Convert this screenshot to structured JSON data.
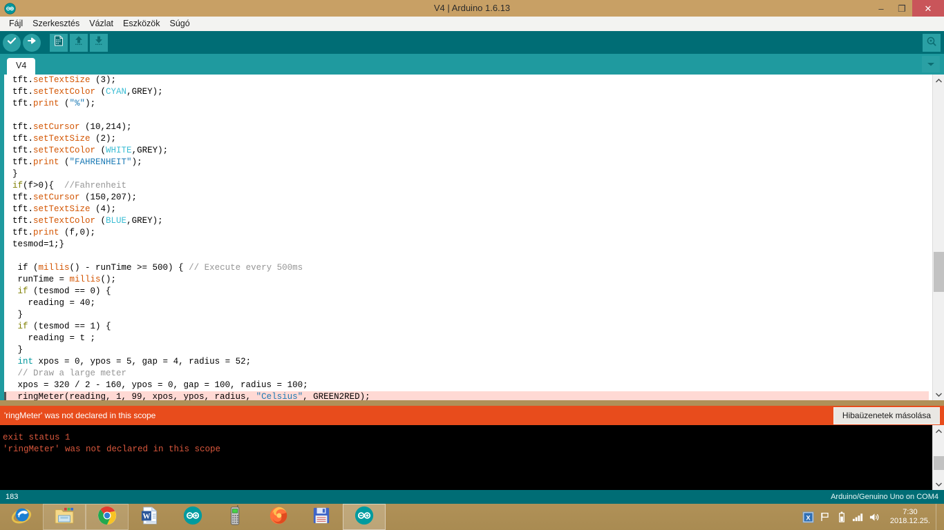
{
  "window": {
    "title": "V4 | Arduino 1.6.13",
    "logo_icon": "arduino-infinity-logo",
    "minimize_label": "–",
    "maximize_label": "❐",
    "close_label": "✕"
  },
  "menubar": {
    "items": [
      {
        "label": "Fájl",
        "name": "menu-file"
      },
      {
        "label": "Szerkesztés",
        "name": "menu-edit"
      },
      {
        "label": "Vázlat",
        "name": "menu-sketch"
      },
      {
        "label": "Eszközök",
        "name": "menu-tools"
      },
      {
        "label": "Súgó",
        "name": "menu-help"
      }
    ]
  },
  "toolbar": {
    "verify": "verify-check-icon",
    "upload": "upload-arrow-icon",
    "new": "new-sketch-icon",
    "open": "open-up-arrow-icon",
    "save": "save-down-arrow-icon",
    "serial_monitor": "serial-monitor-magnifier-icon"
  },
  "tabs": {
    "active": "V4",
    "dropdown_icon": "chevron-down-icon"
  },
  "editor": {
    "lines": [
      {
        "indent": 1,
        "tokens": [
          {
            "t": "tft.",
            "c": "plain"
          },
          {
            "t": "setTextSize",
            "c": "fn"
          },
          {
            "t": " (3);",
            "c": "plain"
          }
        ]
      },
      {
        "indent": 1,
        "tokens": [
          {
            "t": "tft.",
            "c": "plain"
          },
          {
            "t": "setTextColor",
            "c": "fn"
          },
          {
            "t": " (",
            "c": "plain"
          },
          {
            "t": "CYAN",
            "c": "const"
          },
          {
            "t": ",GREY);",
            "c": "plain"
          }
        ]
      },
      {
        "indent": 1,
        "tokens": [
          {
            "t": "tft.",
            "c": "plain"
          },
          {
            "t": "print",
            "c": "fn"
          },
          {
            "t": " (",
            "c": "plain"
          },
          {
            "t": "\"%\"",
            "c": "str"
          },
          {
            "t": ");",
            "c": "plain"
          }
        ]
      },
      {
        "indent": 0,
        "tokens": []
      },
      {
        "indent": 1,
        "tokens": [
          {
            "t": "tft.",
            "c": "plain"
          },
          {
            "t": "setCursor",
            "c": "fn"
          },
          {
            "t": " (10,214);",
            "c": "plain"
          }
        ]
      },
      {
        "indent": 1,
        "tokens": [
          {
            "t": "tft.",
            "c": "plain"
          },
          {
            "t": "setTextSize",
            "c": "fn"
          },
          {
            "t": " (2);",
            "c": "plain"
          }
        ]
      },
      {
        "indent": 1,
        "tokens": [
          {
            "t": "tft.",
            "c": "plain"
          },
          {
            "t": "setTextColor",
            "c": "fn"
          },
          {
            "t": " (",
            "c": "plain"
          },
          {
            "t": "WHITE",
            "c": "const"
          },
          {
            "t": ",GREY);",
            "c": "plain"
          }
        ]
      },
      {
        "indent": 1,
        "tokens": [
          {
            "t": "tft.",
            "c": "plain"
          },
          {
            "t": "print",
            "c": "fn"
          },
          {
            "t": " (",
            "c": "plain"
          },
          {
            "t": "\"FAHRENHEIT\"",
            "c": "str"
          },
          {
            "t": ");",
            "c": "plain"
          }
        ]
      },
      {
        "indent": 1,
        "tokens": [
          {
            "t": "}",
            "c": "plain"
          }
        ]
      },
      {
        "indent": 1,
        "tokens": [
          {
            "t": "if",
            "c": "kw"
          },
          {
            "t": "(f>0){  ",
            "c": "plain"
          },
          {
            "t": "//Fahrenheit",
            "c": "com"
          }
        ]
      },
      {
        "indent": 1,
        "tokens": [
          {
            "t": "tft.",
            "c": "plain"
          },
          {
            "t": "setCursor",
            "c": "fn"
          },
          {
            "t": " (150,207);",
            "c": "plain"
          }
        ]
      },
      {
        "indent": 1,
        "tokens": [
          {
            "t": "tft.",
            "c": "plain"
          },
          {
            "t": "setTextSize",
            "c": "fn"
          },
          {
            "t": " (4);",
            "c": "plain"
          }
        ]
      },
      {
        "indent": 1,
        "tokens": [
          {
            "t": "tft.",
            "c": "plain"
          },
          {
            "t": "setTextColor",
            "c": "fn"
          },
          {
            "t": " (",
            "c": "plain"
          },
          {
            "t": "BLUE",
            "c": "const"
          },
          {
            "t": ",GREY);",
            "c": "plain"
          }
        ]
      },
      {
        "indent": 1,
        "tokens": [
          {
            "t": "tft.",
            "c": "plain"
          },
          {
            "t": "print",
            "c": "fn"
          },
          {
            "t": " (f,0);",
            "c": "plain"
          }
        ]
      },
      {
        "indent": 1,
        "tokens": [
          {
            "t": "tesmod=1;}",
            "c": "plain"
          }
        ]
      },
      {
        "indent": 0,
        "tokens": []
      },
      {
        "indent": 0,
        "tokens": [
          {
            "t": " if (",
            "c": "plain"
          },
          {
            "t": "millis",
            "c": "fn"
          },
          {
            "t": "() - runTime >= 500) { ",
            "c": "plain"
          },
          {
            "t": "// Execute every 500ms",
            "c": "com"
          }
        ]
      },
      {
        "indent": 1,
        "tokens": [
          {
            "t": " runTime = ",
            "c": "plain"
          },
          {
            "t": "millis",
            "c": "fn"
          },
          {
            "t": "();",
            "c": "plain"
          }
        ]
      },
      {
        "indent": 1,
        "tokens": [
          {
            "t": " ",
            "c": "plain"
          },
          {
            "t": "if",
            "c": "kw"
          },
          {
            "t": " (tesmod == 0) {",
            "c": "plain"
          }
        ]
      },
      {
        "indent": 1,
        "tokens": [
          {
            "t": "   reading = 40;",
            "c": "plain"
          }
        ]
      },
      {
        "indent": 1,
        "tokens": [
          {
            "t": " }",
            "c": "plain"
          }
        ]
      },
      {
        "indent": 1,
        "tokens": [
          {
            "t": " ",
            "c": "plain"
          },
          {
            "t": "if",
            "c": "kw"
          },
          {
            "t": " (tesmod == 1) {",
            "c": "plain"
          }
        ]
      },
      {
        "indent": 1,
        "tokens": [
          {
            "t": "   reading = t ;",
            "c": "plain"
          }
        ]
      },
      {
        "indent": 1,
        "tokens": [
          {
            "t": " }",
            "c": "plain"
          }
        ]
      },
      {
        "indent": 1,
        "tokens": [
          {
            "t": " ",
            "c": "plain"
          },
          {
            "t": "int",
            "c": "type"
          },
          {
            "t": " xpos = 0, ypos = 5, gap = 4, radius = 52;",
            "c": "plain"
          }
        ]
      },
      {
        "indent": 1,
        "tokens": [
          {
            "t": " ",
            "c": "plain"
          },
          {
            "t": "// Draw a large meter",
            "c": "com"
          }
        ]
      },
      {
        "indent": 1,
        "tokens": [
          {
            "t": " xpos = 320 / 2 - 160, ypos = 0, gap = 100, radius = 100;",
            "c": "plain"
          }
        ]
      },
      {
        "indent": 1,
        "highlight": true,
        "tokens": [
          {
            "t": " ringMeter(reading, 1, 99, xpos, ypos, radius, ",
            "c": "plain"
          },
          {
            "t": "\"Celsius\"",
            "c": "str"
          },
          {
            "t": ", GREEN2RED);",
            "c": "plain"
          }
        ]
      }
    ],
    "scroll_up_icon": "chevron-up-icon",
    "scroll_down_icon": "chevron-down-icon"
  },
  "error_bar": {
    "message": "'ringMeter' was not declared in this scope",
    "copy_button": "Hibaüzenetek másolása"
  },
  "console": {
    "text": "exit status 1\n'ringMeter' was not declared in this scope"
  },
  "statusbar": {
    "line_number": "183",
    "board": "Arduino/Genuino Uno on COM4"
  },
  "taskbar": {
    "items": [
      {
        "name": "taskbar-internet-explorer",
        "icon": "internet-explorer-icon",
        "style": "plain"
      },
      {
        "name": "taskbar-file-explorer",
        "icon": "file-explorer-folder-icon",
        "style": "boxed"
      },
      {
        "name": "taskbar-chrome",
        "icon": "google-chrome-icon",
        "style": "boxed"
      },
      {
        "name": "taskbar-word",
        "icon": "microsoft-word-icon",
        "style": "plain"
      },
      {
        "name": "taskbar-arduino-1",
        "icon": "arduino-infinity-logo",
        "style": "plain"
      },
      {
        "name": "taskbar-phone",
        "icon": "mobile-phone-icon",
        "style": "plain"
      },
      {
        "name": "taskbar-firefox",
        "icon": "mozilla-firefox-icon",
        "style": "plain"
      },
      {
        "name": "taskbar-save-app",
        "icon": "floppy-disk-icon",
        "style": "plain"
      },
      {
        "name": "taskbar-arduino-active",
        "icon": "arduino-infinity-logo",
        "style": "active"
      }
    ],
    "tray": [
      {
        "name": "tray-app-icon",
        "icon": "app-tray-icon"
      },
      {
        "name": "tray-action-center",
        "icon": "flag-icon"
      },
      {
        "name": "tray-battery",
        "icon": "battery-icon"
      },
      {
        "name": "tray-network",
        "icon": "signal-bars-icon"
      },
      {
        "name": "tray-volume",
        "icon": "speaker-icon"
      }
    ],
    "clock": {
      "time": "7:30",
      "date": "2018.12.25."
    }
  },
  "colors": {
    "titlebar": "#c8a065",
    "toolbar": "#006d75",
    "tabstrip": "#1f9a9f",
    "error": "#e84c1c",
    "console_text": "#d9573c",
    "taskbar": "#b09157"
  }
}
